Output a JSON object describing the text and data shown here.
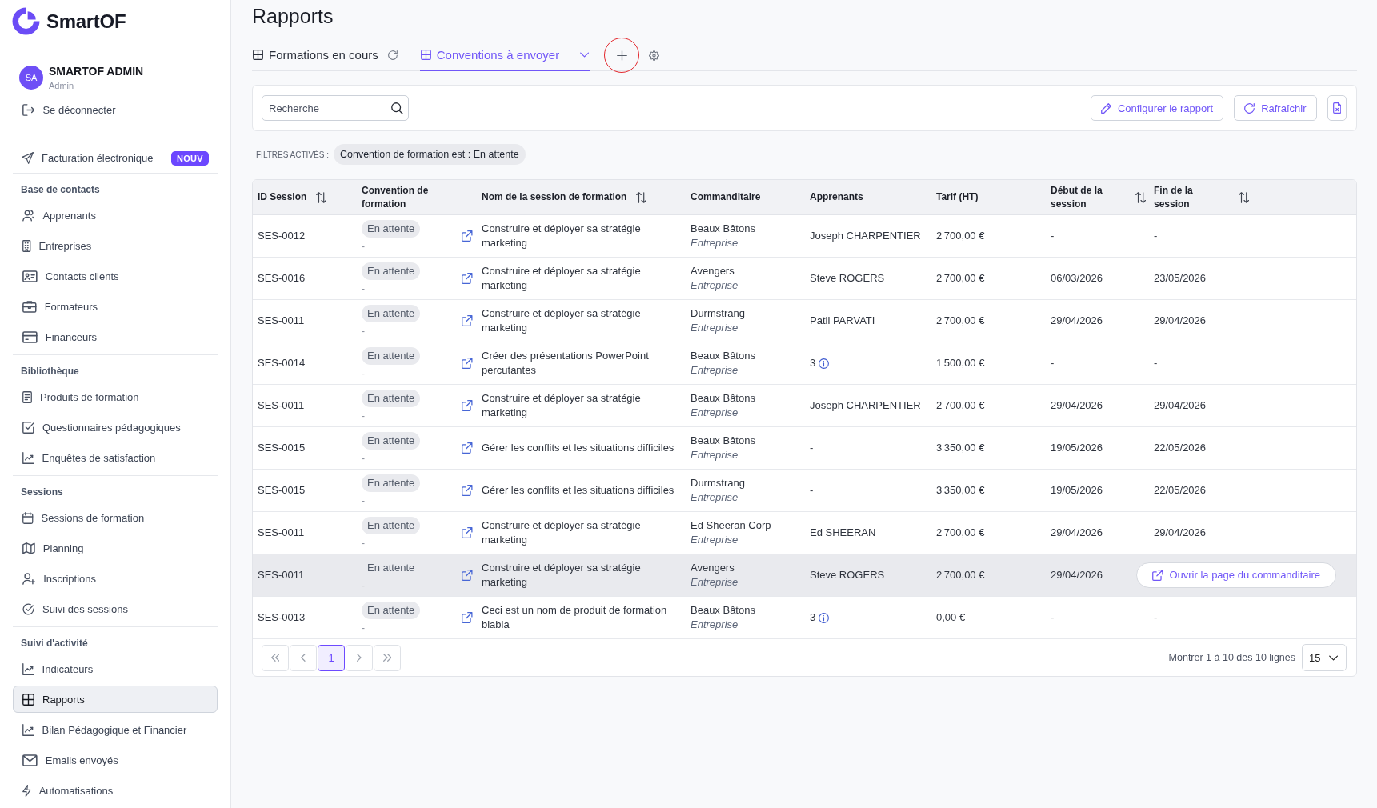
{
  "sidebar": {
    "brand": "SmartOF",
    "user": {
      "initials": "SA",
      "name": "SMARTOF ADMIN",
      "role": "Admin"
    },
    "logout": "Se déconnecter",
    "featured": {
      "label": "Facturation électronique",
      "badge": "NOUV"
    },
    "sections": [
      {
        "title": "Base de contacts",
        "items": [
          {
            "label": "Apprenants",
            "selected": false
          },
          {
            "label": "Entreprises",
            "selected": false
          },
          {
            "label": "Contacts clients",
            "selected": false
          },
          {
            "label": "Formateurs",
            "selected": false
          },
          {
            "label": "Financeurs",
            "selected": false
          }
        ]
      },
      {
        "title": "Bibliothèque",
        "items": [
          {
            "label": "Produits de formation",
            "selected": false
          },
          {
            "label": "Questionnaires pédagogiques",
            "selected": false
          },
          {
            "label": "Enquêtes de satisfaction",
            "selected": false
          }
        ]
      },
      {
        "title": "Sessions",
        "items": [
          {
            "label": "Sessions de formation",
            "selected": false
          },
          {
            "label": "Planning",
            "selected": false
          },
          {
            "label": "Inscriptions",
            "selected": false
          },
          {
            "label": "Suivi des sessions",
            "selected": false
          }
        ]
      },
      {
        "title": "Suivi d'activité",
        "items": [
          {
            "label": "Indicateurs",
            "selected": false
          },
          {
            "label": "Rapports",
            "selected": true
          },
          {
            "label": "Bilan Pédagogique et Financier",
            "selected": false
          },
          {
            "label": "Emails envoyés",
            "selected": false
          },
          {
            "label": "Automatisations",
            "selected": false
          }
        ]
      }
    ]
  },
  "page": {
    "title": "Rapports"
  },
  "tabs": [
    {
      "label": "Formations en cours",
      "selected": false
    },
    {
      "label": "Conventions à envoyer",
      "selected": true
    }
  ],
  "add_tab_button": {
    "circled": true
  },
  "toolbar": {
    "search": {
      "placeholder": "Recherche"
    },
    "buttons": [
      {
        "label": "Configurer le rapport"
      },
      {
        "label": "Rafraîchir"
      }
    ]
  },
  "filters": {
    "label": "FILTRES ACTIVÉS :",
    "chips": [
      "Convention de formation est : En attente"
    ]
  },
  "table": {
    "columns": [
      {
        "label": "ID Session",
        "sortable": true
      },
      {
        "label": "Convention de formation",
        "sortable": false
      },
      {
        "label": "Nom de la session de formation",
        "sortable": true
      },
      {
        "label": "Commanditaire",
        "sortable": false
      },
      {
        "label": "Apprenants",
        "sortable": false
      },
      {
        "label": "Tarif (HT)",
        "sortable": false
      },
      {
        "label": "Début de la session",
        "sortable": true
      },
      {
        "label": "Fin de la session",
        "sortable": true
      }
    ],
    "rows": [
      {
        "id": "SES-0012",
        "status": "En attente",
        "status_note": "-",
        "name": "Construire et déployer sa stratégie marketing",
        "sponsor": "Beaux Bâtons",
        "sponsor_type": "Entreprise",
        "learners": "Joseph CHARPENTIER",
        "learners_info": false,
        "price": "2 700,00 €",
        "start": "-",
        "end": "-",
        "hovered": false
      },
      {
        "id": "SES-0016",
        "status": "En attente",
        "status_note": "-",
        "name": "Construire et déployer sa stratégie marketing",
        "sponsor": "Avengers",
        "sponsor_type": "Entreprise",
        "learners": "Steve ROGERS",
        "learners_info": false,
        "price": "2 700,00 €",
        "start": "06/03/2026",
        "end": "23/05/2026",
        "hovered": false
      },
      {
        "id": "SES-0011",
        "status": "En attente",
        "status_note": "-",
        "name": "Construire et déployer sa stratégie marketing",
        "sponsor": "Durmstrang",
        "sponsor_type": "Entreprise",
        "learners": "Patil PARVATI",
        "learners_info": false,
        "price": "2 700,00 €",
        "start": "29/04/2026",
        "end": "29/04/2026",
        "hovered": false
      },
      {
        "id": "SES-0014",
        "status": "En attente",
        "status_note": "-",
        "name": "Créer des présentations PowerPoint percutantes",
        "sponsor": "Beaux Bâtons",
        "sponsor_type": "Entreprise",
        "learners": "3",
        "learners_info": true,
        "price": "1 500,00 €",
        "start": "-",
        "end": "-",
        "hovered": false
      },
      {
        "id": "SES-0011",
        "status": "En attente",
        "status_note": "-",
        "name": "Construire et déployer sa stratégie marketing",
        "sponsor": "Beaux Bâtons",
        "sponsor_type": "Entreprise",
        "learners": "Joseph CHARPENTIER",
        "learners_info": false,
        "price": "2 700,00 €",
        "start": "29/04/2026",
        "end": "29/04/2026",
        "hovered": false
      },
      {
        "id": "SES-0015",
        "status": "En attente",
        "status_note": "-",
        "name": "Gérer les conflits et les situations difficiles",
        "sponsor": "Beaux Bâtons",
        "sponsor_type": "Entreprise",
        "learners": "-",
        "learners_info": false,
        "price": "3 350,00 €",
        "start": "19/05/2026",
        "end": "22/05/2026",
        "hovered": false
      },
      {
        "id": "SES-0015",
        "status": "En attente",
        "status_note": "-",
        "name": "Gérer les conflits et les situations difficiles",
        "sponsor": "Durmstrang",
        "sponsor_type": "Entreprise",
        "learners": "-",
        "learners_info": false,
        "price": "3 350,00 €",
        "start": "19/05/2026",
        "end": "22/05/2026",
        "hovered": false
      },
      {
        "id": "SES-0011",
        "status": "En attente",
        "status_note": "-",
        "name": "Construire et déployer sa stratégie marketing",
        "sponsor": "Ed Sheeran Corp",
        "sponsor_type": "Entreprise",
        "learners": "Ed SHEERAN",
        "learners_info": false,
        "price": "2 700,00 €",
        "start": "29/04/2026",
        "end": "29/04/2026",
        "hovered": false
      },
      {
        "id": "SES-0011",
        "status": "En attente",
        "status_note": "-",
        "name": "Construire et déployer sa stratégie marketing",
        "sponsor": "Avengers",
        "sponsor_type": "Entreprise",
        "learners": "Steve ROGERS",
        "learners_info": false,
        "price": "2 700,00 €",
        "start": "29/04/2026",
        "hovered": true,
        "action": "Ouvrir la page du commanditaire"
      },
      {
        "id": "SES-0013",
        "status": "En attente",
        "status_note": "-",
        "name": "Ceci est un nom de produit de formation blabla",
        "sponsor": "Beaux Bâtons",
        "sponsor_type": "Entreprise",
        "learners": "3",
        "learners_info": true,
        "price": "0,00 €",
        "start": "-",
        "end": "-",
        "hovered": false
      }
    ]
  },
  "pagination": {
    "pages": [
      {
        "label": "1",
        "selected": true
      }
    ],
    "summary": "Montrer 1 à 10 des 10 lignes",
    "page_size": "15"
  }
}
